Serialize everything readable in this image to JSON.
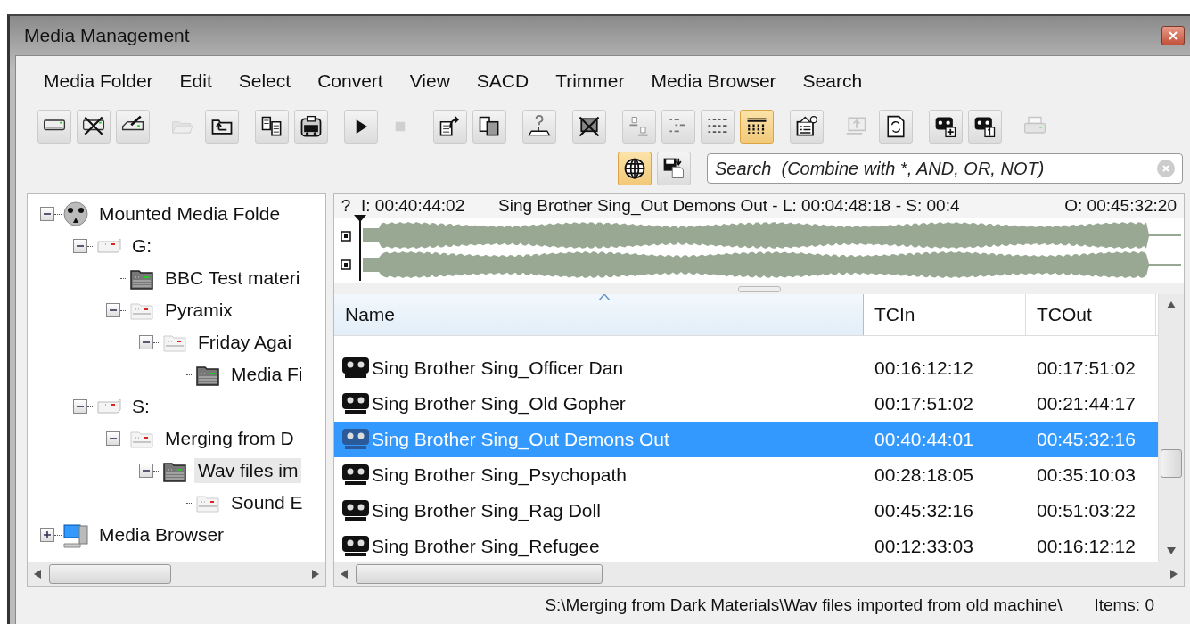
{
  "window": {
    "title": "Media Management"
  },
  "menu": [
    "Media Folder",
    "Edit",
    "Select",
    "Convert",
    "View",
    "SACD",
    "Trimmer",
    "Media Browser",
    "Search"
  ],
  "toolbar": {
    "groups": [
      [
        {
          "kind": "drive",
          "active": false,
          "disabled": false
        },
        {
          "kind": "drive-crossed",
          "active": false,
          "disabled": false
        },
        {
          "kind": "drive-edit",
          "active": false,
          "disabled": false
        }
      ],
      [
        {
          "kind": "folder-open",
          "active": false,
          "disabled": true
        },
        {
          "kind": "folder-up",
          "active": false,
          "disabled": false
        }
      ],
      [
        {
          "kind": "copy",
          "active": false,
          "disabled": false
        },
        {
          "kind": "paste",
          "active": false,
          "disabled": false
        }
      ],
      [
        {
          "kind": "play",
          "active": false,
          "disabled": false
        },
        {
          "kind": "stop",
          "active": false,
          "disabled": true
        }
      ],
      [
        {
          "kind": "export",
          "active": false,
          "disabled": false
        },
        {
          "kind": "copy-doc",
          "active": false,
          "disabled": false
        }
      ],
      [
        {
          "kind": "question",
          "active": false,
          "disabled": false
        }
      ],
      [
        {
          "kind": "crossed-screen",
          "active": false,
          "disabled": false
        }
      ],
      [
        {
          "kind": "view-pair",
          "active": false,
          "disabled": false
        },
        {
          "kind": "view-tree",
          "active": false,
          "disabled": false
        },
        {
          "kind": "view-list",
          "active": false,
          "disabled": false
        },
        {
          "kind": "view-table",
          "active": true,
          "disabled": false
        }
      ],
      [
        {
          "kind": "properties",
          "active": false,
          "disabled": false
        }
      ],
      [
        {
          "kind": "screen-upload",
          "active": false,
          "disabled": true
        },
        {
          "kind": "refresh-doc",
          "active": false,
          "disabled": false
        }
      ],
      [
        {
          "kind": "tape-plus",
          "active": false,
          "disabled": false
        },
        {
          "kind": "tape-one",
          "active": false,
          "disabled": false
        }
      ],
      [
        {
          "kind": "printer",
          "active": false,
          "disabled": true
        }
      ]
    ]
  },
  "toolbar2": {
    "buttons": [
      {
        "kind": "globe",
        "active": true,
        "disabled": false
      },
      {
        "kind": "save-screen",
        "active": false,
        "disabled": false
      }
    ],
    "search": {
      "placeholder": "Search  (Combine with *, AND, OR, NOT)"
    }
  },
  "tree": [
    {
      "label": "Mounted Media Folde",
      "kind": "root",
      "expanded": true,
      "selected": false,
      "children": [
        {
          "label": "G:",
          "kind": "drive",
          "expanded": true,
          "selected": false,
          "children": [
            {
              "label": "BBC Test materi",
              "kind": "media-folder",
              "selected": false
            },
            {
              "label": "Pyramix",
              "kind": "folder",
              "expanded": true,
              "selected": false,
              "children": [
                {
                  "label": "Friday Agai",
                  "kind": "folder",
                  "expanded": true,
                  "selected": false,
                  "children": [
                    {
                      "label": "Media Fi",
                      "kind": "media-folder",
                      "selected": false
                    }
                  ]
                }
              ]
            }
          ]
        },
        {
          "label": "S:",
          "kind": "drive",
          "expanded": true,
          "selected": false,
          "children": [
            {
              "label": "Merging from D",
              "kind": "folder",
              "expanded": true,
              "selected": false,
              "children": [
                {
                  "label": "Wav files im",
                  "kind": "media-folder",
                  "expanded": true,
                  "selected": true,
                  "children": [
                    {
                      "label": "Sound E",
                      "kind": "folder",
                      "selected": false
                    }
                  ]
                }
              ]
            }
          ]
        }
      ]
    },
    {
      "label": "Media Browser",
      "kind": "computer",
      "expanded": false,
      "selected": false
    }
  ],
  "waveform": {
    "help": "?",
    "in": "I: 00:40:44:02",
    "info": "Sing Brother Sing_Out Demons Out - L: 00:04:48:18 - S: 00:4",
    "out": "O: 00:45:32:20"
  },
  "table": {
    "columns": [
      {
        "label": "Name",
        "sorted": true
      },
      {
        "label": "TCIn",
        "sorted": false
      },
      {
        "label": "TCOut",
        "sorted": false
      }
    ],
    "rows": [
      {
        "name": "Sing Brother Sing_Officer Dan",
        "tcin": "00:16:12:12",
        "tcout": "00:17:51:02",
        "selected": false
      },
      {
        "name": "Sing Brother Sing_Old Gopher",
        "tcin": "00:17:51:02",
        "tcout": "00:21:44:17",
        "selected": false
      },
      {
        "name": "Sing Brother Sing_Out Demons Out",
        "tcin": "00:40:44:01",
        "tcout": "00:45:32:16",
        "selected": true
      },
      {
        "name": "Sing Brother Sing_Psychopath",
        "tcin": "00:28:18:05",
        "tcout": "00:35:10:03",
        "selected": false
      },
      {
        "name": "Sing Brother Sing_Rag Doll",
        "tcin": "00:45:32:16",
        "tcout": "00:51:03:22",
        "selected": false
      },
      {
        "name": "Sing Brother Sing_Refugee",
        "tcin": "00:12:33:03",
        "tcout": "00:16:12:12",
        "selected": false
      }
    ]
  },
  "status_bar": {
    "path": "S:\\Merging from Dark Materials\\Wav files imported from old machine\\",
    "items": "Items: 0"
  }
}
